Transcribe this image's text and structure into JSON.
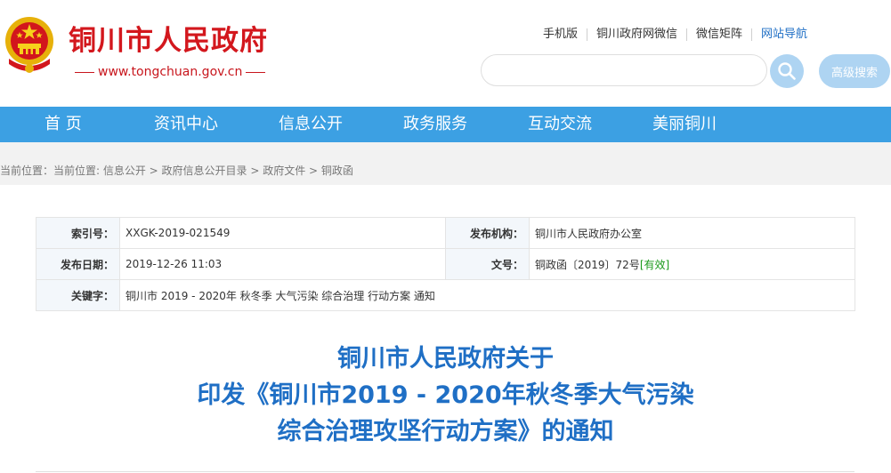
{
  "site": {
    "name": "铜川市人民政府",
    "url": "www.tongchuan.gov.cn",
    "brand_color": "#d3171d"
  },
  "toplinks": [
    {
      "label": "手机版"
    },
    {
      "label": "铜川政府网微信"
    },
    {
      "label": "微信矩阵"
    },
    {
      "label": "网站导航"
    }
  ],
  "search": {
    "value": "",
    "placeholder": "",
    "button_icon": "search-icon",
    "advanced_label": "高级搜索"
  },
  "nav": {
    "color": "#3ca0e3",
    "items": [
      {
        "label": "首 页"
      },
      {
        "label": "资讯中心"
      },
      {
        "label": "信息公开"
      },
      {
        "label": "政务服务"
      },
      {
        "label": "互动交流"
      },
      {
        "label": "美丽铜川"
      }
    ]
  },
  "breadcrumb": "当前位置：当前位置: 信息公开 > 政府信息公开目录 > 政府文件 > 铜政函",
  "meta": {
    "index_label": "索引号：",
    "index_value": "XXGK-2019-021549",
    "issuer_label": "发布机构：",
    "issuer_value": "铜川市人民政府办公室",
    "date_label": "发布日期：",
    "date_value": "2019-12-26 11:03",
    "docno_label": "文号：",
    "docno_value": "铜政函〔2019〕72号",
    "status": "[有效]",
    "keywords_label": "关键字：",
    "keywords_value": "铜川市 2019 - 2020年 秋冬季 大气污染 综合治理 行动方案 通知"
  },
  "title": {
    "line1": "铜川市人民政府关于",
    "line2": "印发《铜川市2019 - 2020年秋冬季大气污染",
    "line3": "综合治理攻坚行动方案》的通知",
    "color": "#1f6fc5"
  }
}
